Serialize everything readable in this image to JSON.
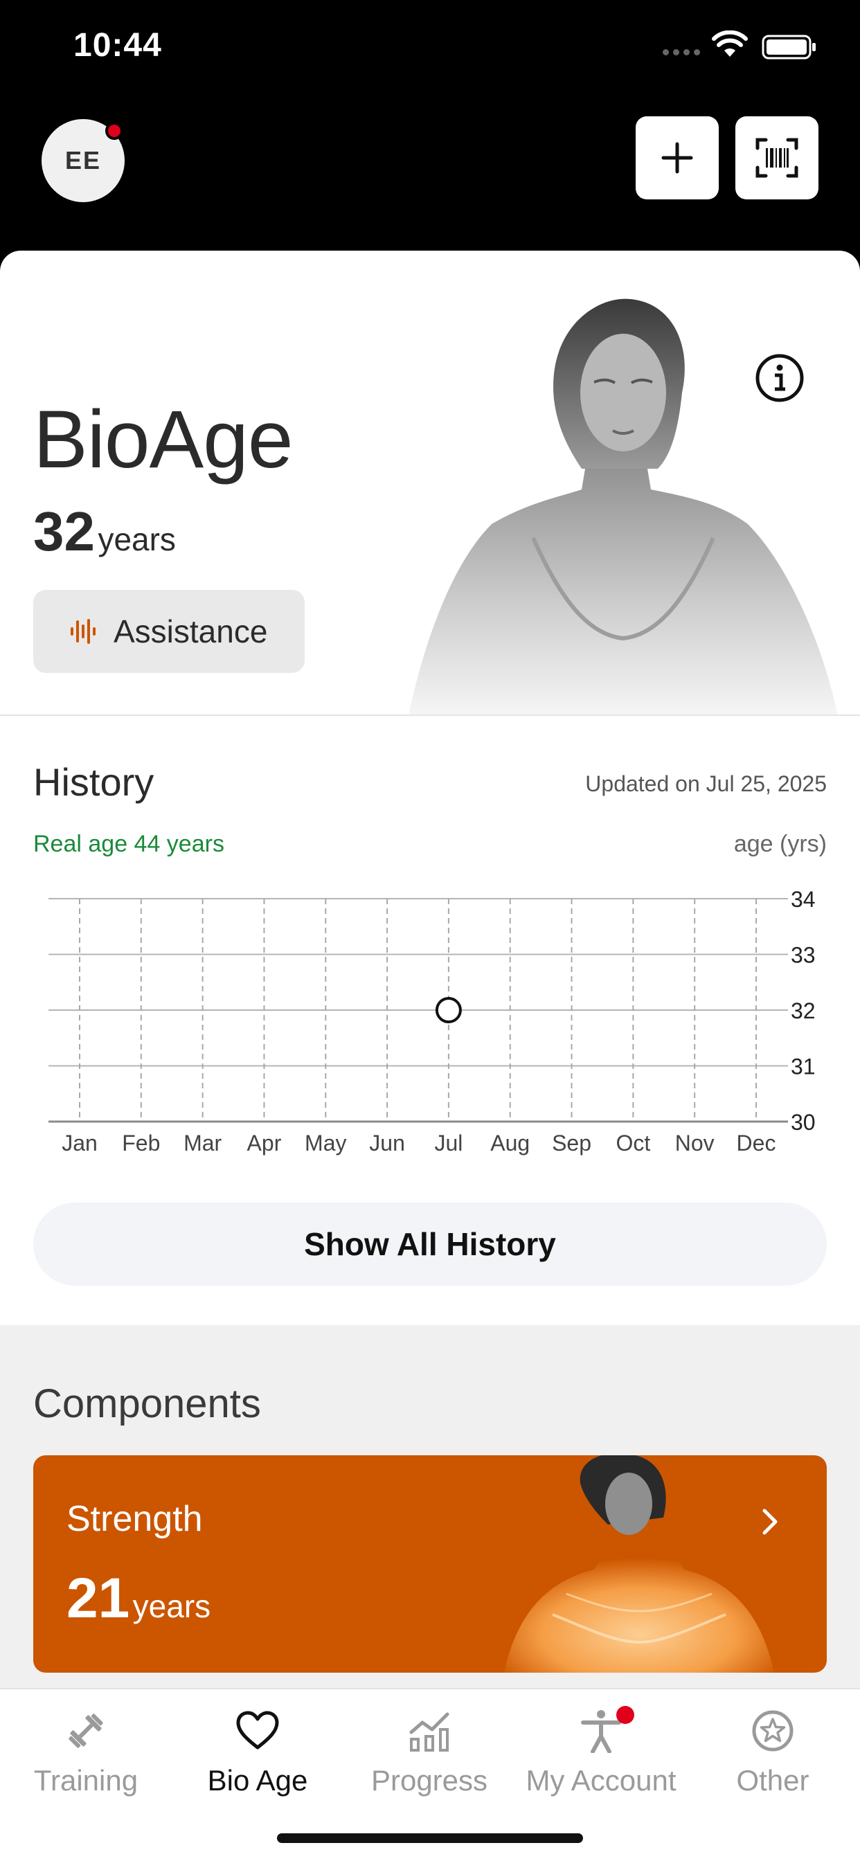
{
  "status_bar": {
    "time": "10:44"
  },
  "header": {
    "avatar_initials": "EE"
  },
  "bioage": {
    "title": "BioAge",
    "age_value": "32",
    "age_unit": "years",
    "assistance_label": "Assistance"
  },
  "history": {
    "title": "History",
    "updated": "Updated on Jul 25, 2025",
    "real_age": "Real age 44 years",
    "axis_unit": "age (yrs)",
    "show_all_label": "Show All History"
  },
  "chart_data": {
    "type": "scatter",
    "categories": [
      "Jan",
      "Feb",
      "Mar",
      "Apr",
      "May",
      "Jun",
      "Jul",
      "Aug",
      "Sep",
      "Oct",
      "Nov",
      "Dec"
    ],
    "y_ticks": [
      30,
      31,
      32,
      33,
      34
    ],
    "ylim": [
      30,
      34
    ],
    "ylabel": "age (yrs)",
    "points": [
      {
        "x": "Jul",
        "y": 32
      }
    ],
    "grid": true
  },
  "components": {
    "title": "Components",
    "strength": {
      "label": "Strength",
      "age_value": "21",
      "age_unit": "years"
    }
  },
  "tabs": [
    {
      "label": "Training",
      "icon": "dumbbell-icon",
      "active": false
    },
    {
      "label": "Bio Age",
      "icon": "heart-icon",
      "active": true
    },
    {
      "label": "Progress",
      "icon": "chart-icon",
      "active": false
    },
    {
      "label": "My Account",
      "icon": "person-icon",
      "active": false
    },
    {
      "label": "Other",
      "icon": "star-icon",
      "active": false
    }
  ],
  "colors": {
    "accent": "#cc5500",
    "real_age_green": "#1a8a3a",
    "badge_red": "#e0001b"
  }
}
